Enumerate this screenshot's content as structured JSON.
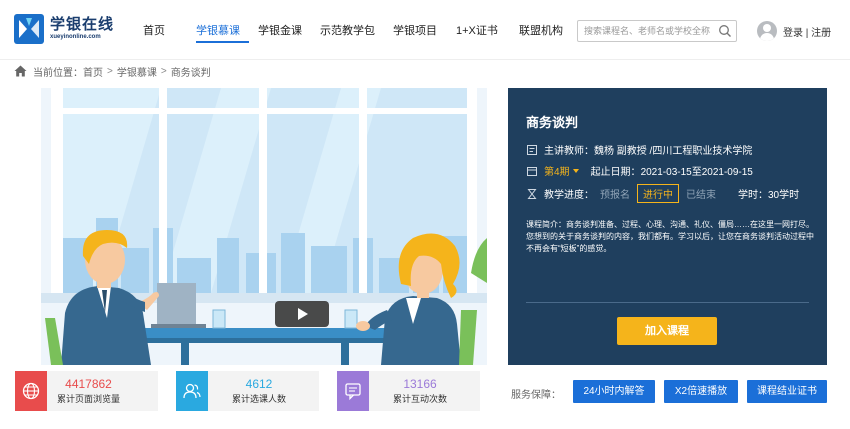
{
  "brand": {
    "name_cn": "学银在线",
    "name_en": "xueyinonline.com",
    "color": "#1a3d6e"
  },
  "nav": [
    {
      "label": "首页",
      "active": false
    },
    {
      "label": "学银慕课",
      "active": true
    },
    {
      "label": "学银金课",
      "active": false
    },
    {
      "label": "示范教学包",
      "active": false
    },
    {
      "label": "学银项目",
      "active": false
    },
    {
      "label": "1+X证书",
      "active": false
    },
    {
      "label": "联盟机构",
      "active": false
    }
  ],
  "search": {
    "placeholder": "搜索课程名、老师名或学校全称",
    "icon": "search-icon"
  },
  "user": {
    "login_register": "登录 | 注册"
  },
  "breadcrumb": {
    "prefix": "当前位置：",
    "items": [
      "首页",
      "学银慕课",
      "商务谈判"
    ],
    "separator": ">"
  },
  "course": {
    "title": "商务谈判",
    "teacher_label": "主讲教师：",
    "teacher": "魏杨 副教授 /四川工程职业技术学院",
    "period": "第4期",
    "start_label": "起止日期：",
    "dates": "2021-03-15至2021-09-15",
    "progress_label": "教学进度：",
    "stages": [
      "预报名",
      "进行中",
      "已结束"
    ],
    "current_stage": "进行中",
    "hours_label": "学时：",
    "hours": "30学时",
    "description": "课程简介：商务谈判准备、过程、心理、沟通、礼仪、僵局……在这里一网打尽。您想到的关于商务谈判的内容，我们都有。学习以后，让您在商务谈判活动过程中不再会有“短板”的感觉。",
    "join_label": "加入课程",
    "accent": "#f5b41b",
    "panel_bg": "#1f3f5e"
  },
  "stats": [
    {
      "value": "4417862",
      "label": "累计页面浏览量",
      "color": "#e84c4c",
      "icon": "globe-icon"
    },
    {
      "value": "4612",
      "label": "累计选课人数",
      "color": "#2aa9e0",
      "icon": "users-icon"
    },
    {
      "value": "13166",
      "label": "累计互动次数",
      "color": "#9b7ad8",
      "icon": "chat-icon"
    }
  ],
  "guarantees": {
    "label": "服务保障：",
    "items": [
      "24小时内解答",
      "X2倍速播放",
      "课程结业证书"
    ]
  }
}
